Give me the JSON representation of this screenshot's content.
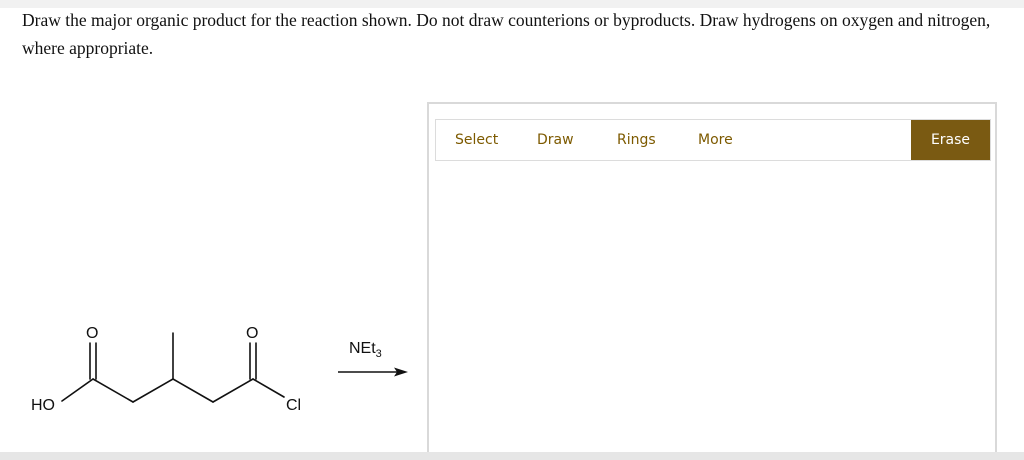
{
  "question": {
    "text": "Draw the major organic product for the reaction shown. Do not draw counterions or byproducts. Draw hydrogens on oxygen and nitrogen, where appropriate."
  },
  "reaction": {
    "reagent": "NEt",
    "reagent_subscript": "3",
    "labels": {
      "oxygen_left": "O",
      "oxygen_right": "O",
      "hydroxyl": "HO",
      "chlorine": "Cl"
    }
  },
  "editor": {
    "tools": [
      "Select",
      "Draw",
      "Rings",
      "More"
    ],
    "erase_label": "Erase",
    "accent_color": "#7a5a12",
    "tool_text_color": "#7d5a00"
  }
}
